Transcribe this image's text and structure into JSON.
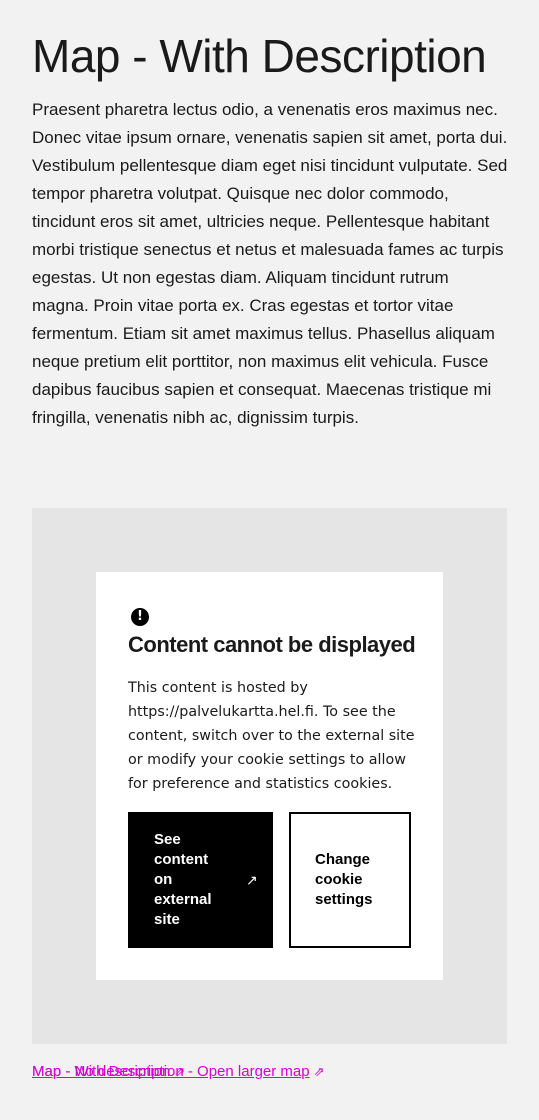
{
  "page": {
    "title": "Map - With Description",
    "description": "Praesent pharetra lectus odio, a venenatis eros maximus nec. Donec vitae ipsum ornare, venenatis sapien sit amet, porta dui. Vestibulum pellentesque diam eget nisi tincidunt vulputate. Sed tempor pharetra volutpat. Quisque nec dolor commodo, tincidunt eros sit amet, ultricies neque. Pellentesque habitant morbi tristique senectus et netus et malesuada fames ac turpis egestas. Ut non egestas diam. Aliquam tincidunt rutrum magna. Proin vitae porta ex. Cras egestas et tortor vitae fermentum. Etiam sit amet maximus tellus. Phasellus aliquam neque pretium elit porttitor, non maximus elit vehicula. Fusce dapibus faucibus sapien et consequat. Maecenas tristique mi fringilla, venenatis nibh ac, dignissim turpis."
  },
  "notice": {
    "icon": "alert-circle-icon",
    "title": "Content cannot be displayed",
    "text": "This content is hosted by https://palvelukartta.hel.fi. To see the content, switch over to the external site or modify your cookie settings to allow for preference and statistics cookies.",
    "external_button": "See content on external site",
    "external_icon": "↗",
    "cookie_button": "Change cookie settings"
  },
  "links": {
    "overlap_a": "Map - No description",
    "overlap_b": "Map - With Description - Open larger map",
    "link_icon": "⇗",
    "color": "#d400d4"
  },
  "colors": {
    "background": "#f2f2f2",
    "map_area": "#e5e5e5",
    "button_dark": "#000000"
  }
}
